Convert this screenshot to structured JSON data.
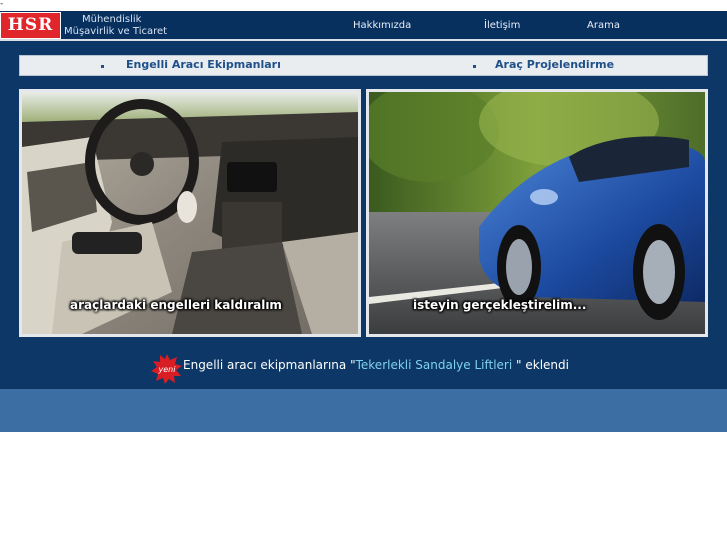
{
  "page": {
    "stray_mark": "-"
  },
  "colors": {
    "header_bg": "#08305f",
    "main_bg": "#0c3766",
    "footer_bg": "#3d6ea3",
    "logo_red": "#e1262b",
    "link_blue": "#20508a",
    "highlight_cyan": "#7fd2ee"
  },
  "header": {
    "logo_text": "HSR",
    "tagline_line1": "Mühendislik",
    "tagline_line2": "Müşavirlik ve Ticaret",
    "nav": [
      {
        "label": "Hakkımızda"
      },
      {
        "label": "İletişim"
      },
      {
        "label": "Arama"
      }
    ]
  },
  "categories": [
    {
      "label": "Engelli Aracı Ekipmanları"
    },
    {
      "label": "Araç Projelendirme"
    }
  ],
  "photos": [
    {
      "caption": "araçlardaki engelleri kaldıralım"
    },
    {
      "caption": "isteyin gerçekleştirelim..."
    }
  ],
  "news": {
    "badge": "yeni",
    "prefix": "Engelli aracı ekipmanlarına",
    "open_quote": "\"",
    "highlight": "Tekerlekli Sandalye Liftleri",
    "close_quote": "\"",
    "suffix": "eklendi"
  }
}
